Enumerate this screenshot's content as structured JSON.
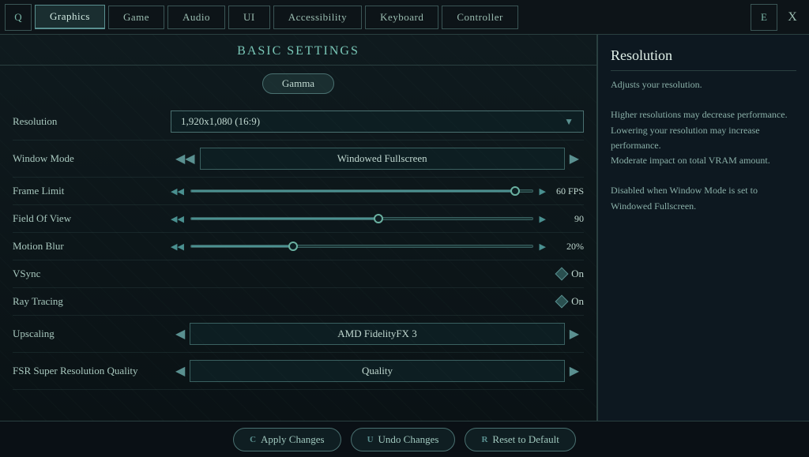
{
  "nav": {
    "tabs": [
      {
        "label": "Q",
        "icon": true,
        "active": false
      },
      {
        "label": "Graphics",
        "active": true
      },
      {
        "label": "Game",
        "active": false
      },
      {
        "label": "Audio",
        "active": false
      },
      {
        "label": "UI",
        "active": false
      },
      {
        "label": "Accessibility",
        "active": false
      },
      {
        "label": "Keyboard",
        "active": false
      },
      {
        "label": "Controller",
        "active": false
      },
      {
        "label": "E",
        "icon": true,
        "active": false
      }
    ],
    "close_label": "X"
  },
  "section": {
    "title": "Basic Settings",
    "subtab": "Gamma"
  },
  "settings": [
    {
      "label": "Resolution",
      "type": "dropdown",
      "value": "1,920x1,080 (16:9)"
    },
    {
      "label": "Window Mode",
      "type": "arrow-selector",
      "value": "Windowed Fullscreen"
    },
    {
      "label": "Frame Limit",
      "type": "slider",
      "value": "60 FPS",
      "fill_pct": 95
    },
    {
      "label": "Field Of View",
      "type": "slider",
      "value": "90",
      "fill_pct": 55
    },
    {
      "label": "Motion Blur",
      "type": "slider",
      "value": "20%",
      "fill_pct": 30
    },
    {
      "label": "VSync",
      "type": "toggle",
      "value": "On"
    },
    {
      "label": "Ray Tracing",
      "type": "toggle",
      "value": "On"
    },
    {
      "label": "Upscaling",
      "type": "arrow-selector",
      "value": "AMD FidelityFX 3"
    },
    {
      "label": "FSR Super Resolution Quality",
      "type": "arrow-selector",
      "value": "Quality"
    }
  ],
  "info_panel": {
    "title": "Resolution",
    "text": "Adjusts your resolution.\n\nHigher resolutions may decrease performance. Lowering your resolution may increase performance.\nModerate impact on total VRAM amount.\n\nDisabled when Window Mode is set to Windowed Fullscreen."
  },
  "bottom_bar": {
    "apply": "Apply Changes",
    "undo": "Undo Changes",
    "reset": "Reset to Default",
    "apply_key": "C",
    "undo_key": "U",
    "reset_key": "R"
  }
}
